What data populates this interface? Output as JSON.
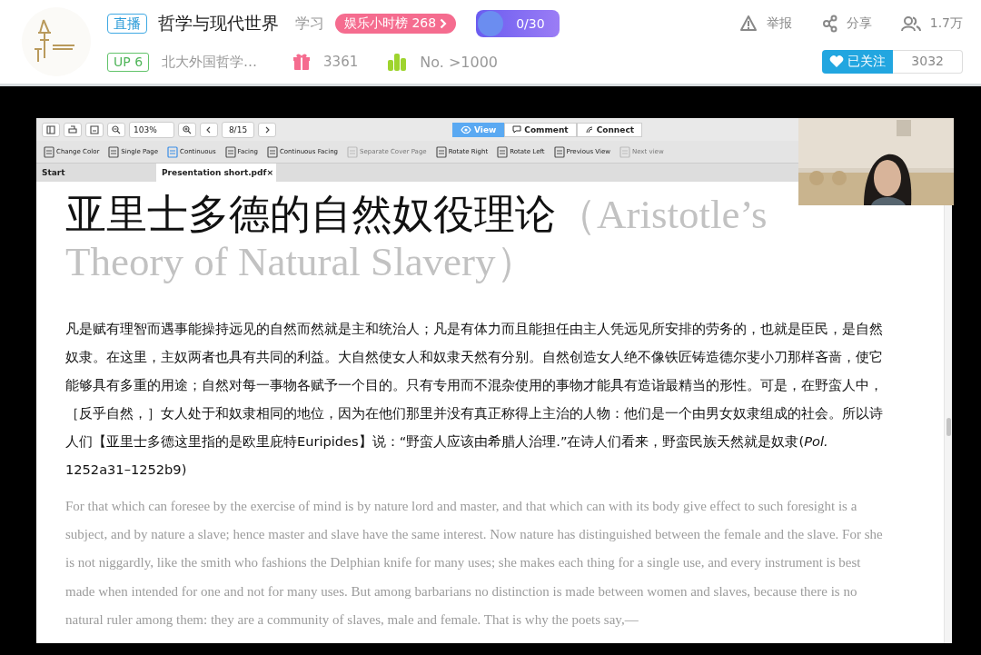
{
  "header": {
    "live_badge": "直播",
    "title": "哲学与现代世界",
    "category": "学习",
    "rank_badge": "娱乐小时榜 268",
    "task_progress": "0/30",
    "actions": [
      {
        "kind": "report",
        "label": "举报"
      },
      {
        "kind": "share",
        "label": "分享"
      },
      {
        "kind": "viewers",
        "label": "1.7万"
      }
    ],
    "level_badge": "UP 6",
    "streamer": "北大外国哲学…",
    "gifts": "3361",
    "rank": "No. >1000",
    "follow_button": "已关注",
    "followers": "3032"
  },
  "pdf_viewer": {
    "zoom": "103%",
    "page": "8/15",
    "modes": [
      {
        "kind": "view",
        "label": "View",
        "selected": true
      },
      {
        "kind": "comment",
        "label": "Comment",
        "selected": false
      },
      {
        "kind": "connect",
        "label": "Connect",
        "selected": false
      }
    ],
    "tools": [
      {
        "kind": "color",
        "label": "Change Color",
        "disabled": false
      },
      {
        "kind": "single",
        "label": "Single Page",
        "disabled": false
      },
      {
        "kind": "continuous",
        "label": "Continuous",
        "disabled": false
      },
      {
        "kind": "facing",
        "label": "Facing",
        "disabled": false
      },
      {
        "kind": "cfacing",
        "label": "Continuous Facing",
        "disabled": false
      },
      {
        "kind": "cover",
        "label": "Separate Cover Page",
        "disabled": true
      },
      {
        "kind": "rotr",
        "label": "Rotate Right",
        "disabled": false
      },
      {
        "kind": "rotl",
        "label": "Rotate Left",
        "disabled": false
      },
      {
        "kind": "prev",
        "label": "Previous View",
        "disabled": false
      },
      {
        "kind": "next",
        "label": "Next view",
        "disabled": true
      }
    ],
    "tabs": [
      {
        "label": "Start",
        "selected": false
      },
      {
        "label": "Presentation short.pdf",
        "selected": true,
        "close": "×"
      }
    ],
    "slide": {
      "title_zh": "亚里士多德的自然奴役理论",
      "title_en": "（Aristotle’s Theory of Natural Slavery）",
      "paragraph_zh": "凡是赋有理智而遇事能操持远见的自然而然就是主和统治人；凡是有体力而且能担任由主人凭远见所安排的劳务的，也就是臣民，是自然奴隶。在这里，主奴两者也具有共同的利益。大自然使女人和奴隶天然有分别。自然创造女人绝不像铁匠铸造德尔斐小刀那样吝啬，使它能够具有多重的用途；自然对每一事物各赋予一个目的。只有专用而不混杂使用的事物才能具有造诣最精当的形性。可是，在野蛮人中，［反乎自然，］女人处于和奴隶相同的地位，因为在他们那里并没有真正称得上主治的人物：他们是一个由男女奴隶组成的社会。所以诗人们【亚里士多德这里指的是欧里庇特Euripides】说：“野蛮人应该由希腊人治理.”在诗人们看来，野蛮民族天然就是奴隶(*Pol.* 1252a31–1252b9)",
      "paragraph_en": "For that which can foresee by the exercise of mind is by nature lord and master, and that which can with its body give effect to such foresight is a subject, and by nature a slave; hence master and slave have the same interest. Now nature has distinguished between the female and the slave. For she is not niggardly, like the smith who fashions the Delphian knife for many uses; she makes each thing for a single use, and every instrument is best made when intended for one and not for many uses. But among barbarians no distinction is made between women and slaves, because there is no natural ruler among them: they are a community of slaves, male and female. That is why the poets say,—"
    }
  }
}
